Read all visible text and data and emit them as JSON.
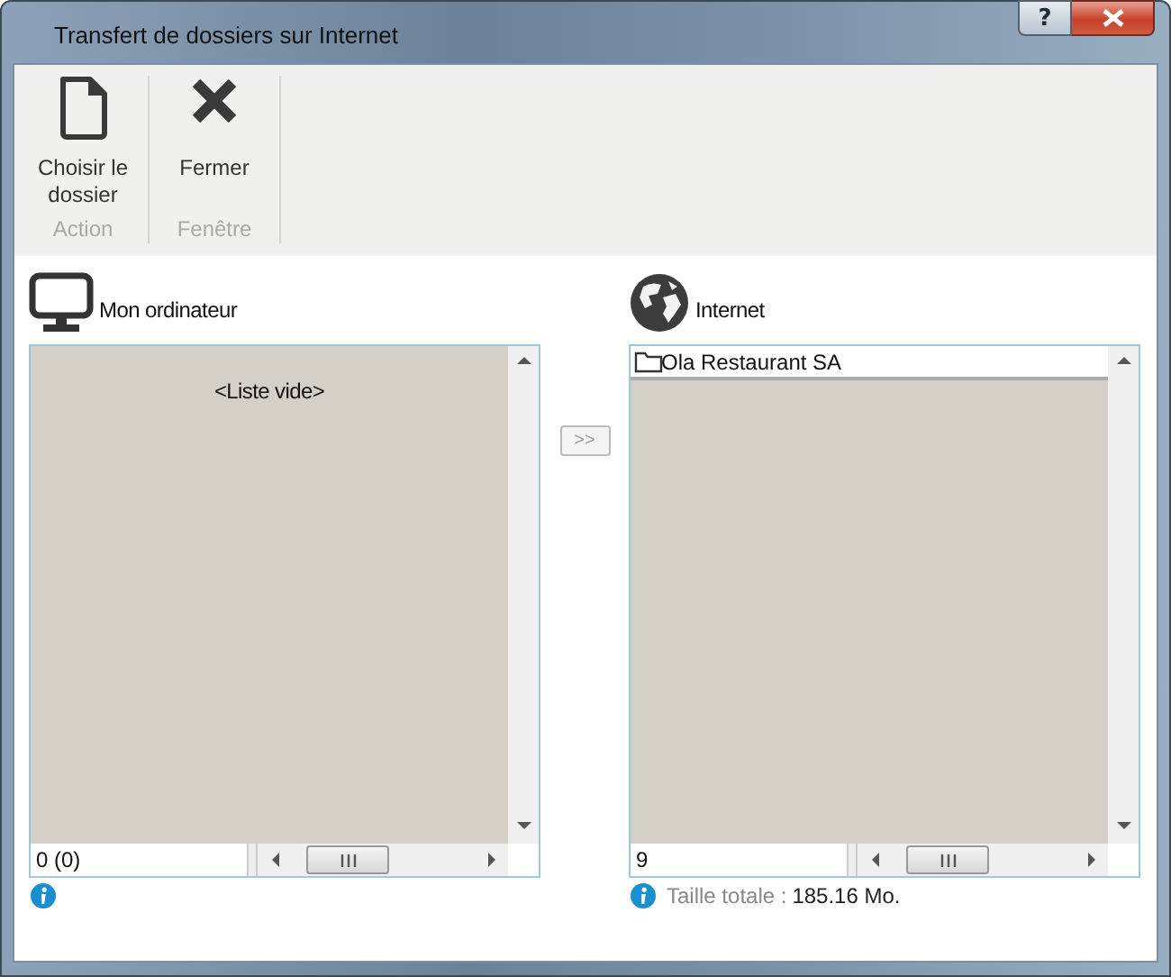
{
  "window": {
    "title": "Transfert de dossiers sur Internet",
    "help_button": "?"
  },
  "ribbon": {
    "groups": [
      {
        "label": "Action",
        "buttons": [
          {
            "label": "Choisir le dossier",
            "kind": "file"
          }
        ]
      },
      {
        "label": "Fenêtre",
        "buttons": [
          {
            "label": "Fermer",
            "kind": "close"
          }
        ]
      }
    ]
  },
  "panels": [
    {
      "title": "Mon ordinateur",
      "kind": "computer",
      "empty_text": "<Liste vide>",
      "count": "0 (0)",
      "info_icon": true
    },
    {
      "title": "Internet",
      "kind": "globe",
      "items": [
        {
          "label": "Ola Restaurant SA",
          "kind": "folder"
        }
      ],
      "count": "9",
      "info_icon": true,
      "info": {
        "label": "Taille totale :",
        "value": "185.16 Mo."
      }
    }
  ],
  "transfer_button": ">>"
}
